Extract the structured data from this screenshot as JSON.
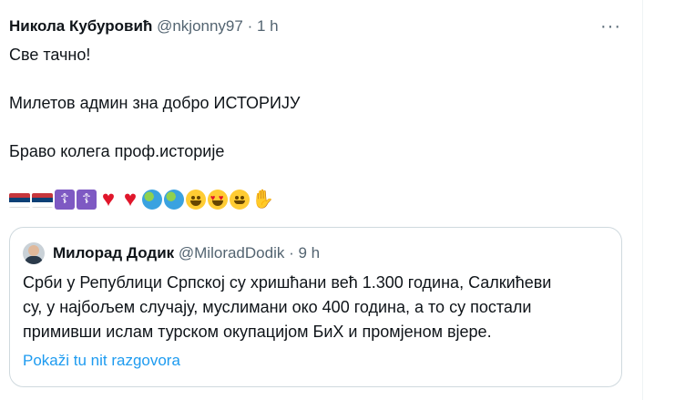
{
  "tweet": {
    "author_name": "Никола Кубуровић",
    "author_handle": "@nkjonny97",
    "separator": "·",
    "time": "1 h",
    "more_label": "···",
    "text_lines": [
      "Све тачно!",
      "Милетов админ зна добро ИСТОРИЈУ",
      "Браво колега проф.историје"
    ],
    "emojis": [
      "serbia-flag",
      "serbia-flag",
      "orthodox-cross",
      "orthodox-cross",
      "red-heart",
      "red-heart",
      "globe",
      "globe",
      "grinning-face",
      "heart-eyes-face",
      "smiling-face",
      "raised-hand"
    ]
  },
  "quote": {
    "author_name": "Милорад Додик",
    "author_handle": "@MiloradDodik",
    "separator": "·",
    "time": "9 h",
    "text_lines": [
      "Срби у Републици Српској су хришћани већ 1.300 година, Салкићеви",
      "су, у најбољем случају, муслимани око 400 година, а то су постали",
      "примивши ислам турском окупацијом БиХ и промјеном вјере."
    ],
    "link_text": "Pokaži tu nit razgovora"
  },
  "colors": {
    "text": "#0f1419",
    "secondary": "#536471",
    "link": "#1d9bf0",
    "border": "#cfd9de"
  }
}
